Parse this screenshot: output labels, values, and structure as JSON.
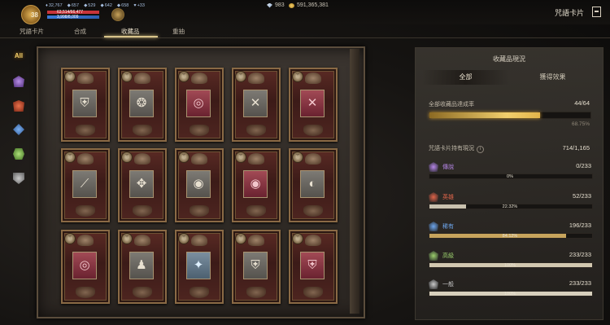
{
  "hud": {
    "level": "38",
    "stats": [
      {
        "icon": "shield-icon",
        "value": "32,767"
      },
      {
        "icon": "ring-icon",
        "value": "657"
      },
      {
        "icon": "amulet-icon",
        "value": "529"
      },
      {
        "icon": "boot-icon",
        "value": "642"
      },
      {
        "icon": "sword-icon",
        "value": "658"
      },
      {
        "icon": "heart-icon",
        "value": "+33"
      }
    ],
    "hp_text": "63,514/66,477",
    "mp_text": "3,998/8,009",
    "gems": "983",
    "gold": "591,365,381",
    "screen_title": "咒語卡片"
  },
  "tabs": [
    {
      "label": "咒語卡片"
    },
    {
      "label": "合成"
    },
    {
      "label": "收藏品",
      "active": true
    },
    {
      "label": "重抽"
    }
  ],
  "filters": {
    "all_label": "All",
    "items": [
      "legendary-filter-icon",
      "hero-filter-icon",
      "rare-filter-icon",
      "master-filter-icon",
      "common-filter-icon"
    ]
  },
  "cards": [
    {
      "row": 0,
      "col": 0,
      "glyph": "⛨",
      "tone": "gray"
    },
    {
      "row": 0,
      "col": 1,
      "glyph": "❂",
      "tone": "gray"
    },
    {
      "row": 0,
      "col": 2,
      "glyph": "◎",
      "tone": "pink"
    },
    {
      "row": 0,
      "col": 3,
      "glyph": "✕",
      "tone": "gray"
    },
    {
      "row": 0,
      "col": 4,
      "glyph": "✕",
      "tone": "pink"
    },
    {
      "row": 1,
      "col": 0,
      "glyph": "⟋",
      "tone": "gray"
    },
    {
      "row": 1,
      "col": 1,
      "glyph": "✥",
      "tone": "gray"
    },
    {
      "row": 1,
      "col": 2,
      "glyph": "◉",
      "tone": "gray"
    },
    {
      "row": 1,
      "col": 3,
      "glyph": "◉",
      "tone": "pink"
    },
    {
      "row": 1,
      "col": 4,
      "glyph": "◐",
      "tone": "gray"
    },
    {
      "row": 2,
      "col": 0,
      "glyph": "◎",
      "tone": "pink"
    },
    {
      "row": 2,
      "col": 1,
      "glyph": "♟",
      "tone": "gray"
    },
    {
      "row": 2,
      "col": 2,
      "glyph": "✦",
      "tone": "blue"
    },
    {
      "row": 2,
      "col": 3,
      "glyph": "⛨",
      "tone": "gray"
    },
    {
      "row": 2,
      "col": 4,
      "glyph": "⛨",
      "tone": "pink"
    }
  ],
  "panel": {
    "title": "收藏品現況",
    "seg_all": "全部",
    "seg_effect": "獲得效果",
    "completion_label": "全部收藏品達成率",
    "completion_value": "44/64",
    "completion_pct": "68.75%",
    "completion_fraction": 0.6875,
    "owned_label": "咒語卡片持有現況",
    "owned_value": "714/1,165",
    "rarities": [
      {
        "name": "傳說",
        "count": "0/233",
        "pct": "0%",
        "fraction": 0.0,
        "color": "#b687e8",
        "fill": "#8d5cc9",
        "icon": "legendary-rarity-icon"
      },
      {
        "name": "英雄",
        "count": "52/233",
        "pct": "22.32%",
        "fraction": 0.2232,
        "color": "#e0654a",
        "fill": "#c9c1ae",
        "icon": "hero-rarity-icon"
      },
      {
        "name": "稀有",
        "count": "196/233",
        "pct": "84.12%",
        "fraction": 0.8412,
        "color": "#6ea7ee",
        "fill": "#c7a45c",
        "icon": "rare-rarity-icon"
      },
      {
        "name": "高級",
        "count": "233/233",
        "pct": "100%",
        "fraction": 1.0,
        "color": "#9ccf6d",
        "fill": "#d2c8b0",
        "icon": "master-rarity-icon"
      },
      {
        "name": "一般",
        "count": "233/233",
        "pct": "100%",
        "fraction": 1.0,
        "color": "#c8c8c8",
        "fill": "#d8d0bd",
        "icon": "common-rarity-icon"
      }
    ]
  }
}
